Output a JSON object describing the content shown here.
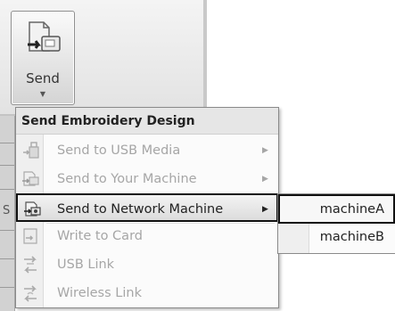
{
  "ribbon": {
    "send_button": {
      "label": "Send",
      "icon": "send-icon",
      "dropdown_icon": "chevron-down-icon"
    }
  },
  "strip": {
    "letter": "S"
  },
  "menu": {
    "header": "Send Embroidery Design",
    "items": [
      {
        "label": "Send to USB Media",
        "icon": "usb-icon",
        "enabled": false,
        "has_submenu": true
      },
      {
        "label": "Send to Your Machine",
        "icon": "machine-icon",
        "enabled": false,
        "has_submenu": true
      },
      {
        "label": "Send to Network Machine",
        "icon": "network-machine-icon",
        "enabled": true,
        "has_submenu": true,
        "highlighted": true
      },
      {
        "label": "Write to Card",
        "icon": "card-icon",
        "enabled": false,
        "has_submenu": false
      },
      {
        "label": "USB Link",
        "icon": "usb-link-icon",
        "enabled": false,
        "has_submenu": false
      },
      {
        "label": "Wireless Link",
        "icon": "wireless-link-icon",
        "enabled": false,
        "has_submenu": false
      }
    ],
    "submenu_arrow": "▶"
  },
  "submenu": {
    "items": [
      {
        "label": "machineA",
        "selected": true
      },
      {
        "label": "machineB",
        "selected": false
      }
    ]
  },
  "colors": {
    "disabled_text": "#a6a6a6",
    "highlight_border": "#111111"
  }
}
